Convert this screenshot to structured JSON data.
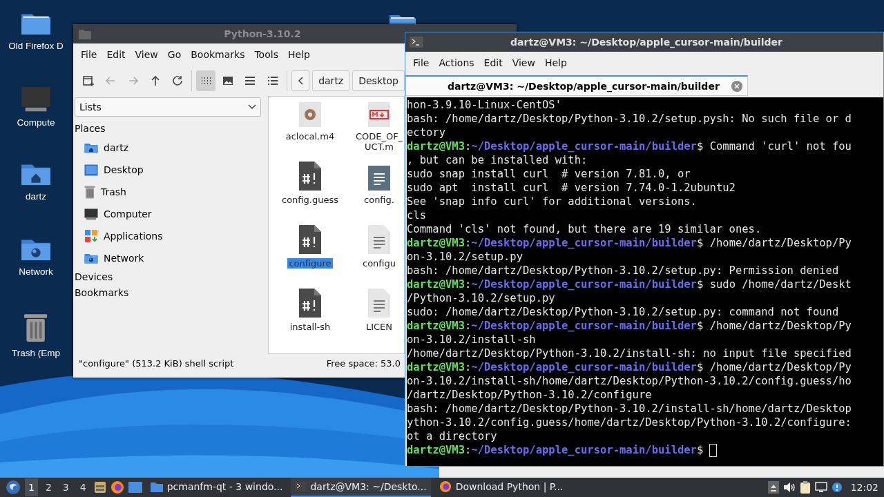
{
  "desktop_icons": [
    {
      "label": "Old Firefox D",
      "kind": "folder"
    },
    {
      "label": "Compute",
      "kind": "computer"
    },
    {
      "label": "dartz",
      "kind": "home"
    },
    {
      "label": "Network",
      "kind": "network"
    },
    {
      "label": "Trash (Emp",
      "kind": "trash"
    }
  ],
  "file_manager": {
    "title": "Python-3.10.2",
    "menu": [
      "File",
      "Edit",
      "View",
      "Go",
      "Bookmarks",
      "Tools",
      "Help"
    ],
    "toolbar": [
      {
        "kind": "new-window",
        "disabled": false,
        "selected": false
      },
      {
        "kind": "back",
        "disabled": true,
        "selected": false
      },
      {
        "kind": "forward",
        "disabled": true,
        "selected": false
      },
      {
        "kind": "up",
        "disabled": false,
        "selected": false
      },
      {
        "kind": "reload",
        "disabled": false,
        "selected": false
      },
      {
        "kind": "icon-view",
        "disabled": false,
        "selected": true
      },
      {
        "kind": "thumbnail-view",
        "disabled": false,
        "selected": false
      },
      {
        "kind": "compact-view",
        "disabled": false,
        "selected": false
      },
      {
        "kind": "detail-view",
        "disabled": false,
        "selected": false
      }
    ],
    "breadcrumbs": [
      "dartz",
      "Desktop"
    ],
    "sidebar": {
      "mode": "Lists",
      "sections": [
        {
          "title": "Places",
          "items": [
            {
              "label": "dartz",
              "kind": "home"
            },
            {
              "label": "Desktop",
              "kind": "desktop"
            },
            {
              "label": "Trash",
              "kind": "trash"
            },
            {
              "label": "Computer",
              "kind": "computer"
            },
            {
              "label": "Applications",
              "kind": "apps"
            },
            {
              "label": "Network",
              "kind": "network"
            }
          ]
        },
        {
          "title": "Devices"
        },
        {
          "title": "Bookmarks"
        }
      ]
    },
    "files": [
      {
        "lines": [
          "aclocal.m4"
        ],
        "kind": "config",
        "selected": false
      },
      {
        "lines": [
          "CODE_OF_",
          "UCT.m"
        ],
        "kind": "markdown",
        "selected": false
      },
      {
        "lines": [
          "config.guess"
        ],
        "kind": "script",
        "selected": false
      },
      {
        "lines": [
          "config."
        ],
        "kind": "document",
        "selected": false
      },
      {
        "lines": [
          "configure"
        ],
        "kind": "script",
        "selected": true
      },
      {
        "lines": [
          "configu"
        ],
        "kind": "text",
        "selected": false
      },
      {
        "lines": [
          "install-sh"
        ],
        "kind": "script",
        "selected": false
      },
      {
        "lines": [
          "LICEN"
        ],
        "kind": "text",
        "selected": false
      }
    ],
    "status": "\"configure\" (513.2 KiB) shell script",
    "free_space": "Free space: 53.0"
  },
  "terminal": {
    "title": "dartz@VM3: ~/Desktop/apple_cursor-main/builder",
    "menu": [
      "File",
      "Actions",
      "Edit",
      "View",
      "Help"
    ],
    "tab": {
      "label": "dartz@VM3: ~/Desktop/apple_cursor-main/builder",
      "selected": true
    },
    "lines": [
      {
        "kind": "output",
        "text": "hon-3.9.10-Linux-CentOS'"
      },
      {
        "kind": "output",
        "text": "bash: /home/dartz/Desktop/Python-3.10.2/setup.pysh: No such file or d"
      },
      {
        "kind": "output",
        "text": "ectory"
      },
      {
        "kind": "prompt",
        "user": "dartz@VM3",
        "sep": ":",
        "path": "~/Desktop/apple_cursor-main/builder",
        "command": "$ Command 'curl' not fou"
      },
      {
        "kind": "output",
        "text": ", but can be installed with:"
      },
      {
        "kind": "output",
        "text": "sudo snap install curl  # version 7.81.0, or"
      },
      {
        "kind": "output",
        "text": "sudo apt  install curl  # version 7.74.0-1.2ubuntu2"
      },
      {
        "kind": "output",
        "text": "See 'snap info curl' for additional versions."
      },
      {
        "kind": "output",
        "text": "cls"
      },
      {
        "kind": "output",
        "text": "Command 'cls' not found, but there are 19 similar ones."
      },
      {
        "kind": "prompt",
        "user": "dartz@VM3",
        "sep": ":",
        "path": "~/Desktop/apple_cursor-main/builder",
        "command": "$ /home/dartz/Desktop/Py"
      },
      {
        "kind": "output",
        "text": "on-3.10.2/setup.py"
      },
      {
        "kind": "output",
        "text": "bash: /home/dartz/Desktop/Python-3.10.2/setup.py: Permission denied"
      },
      {
        "kind": "prompt",
        "user": "dartz@VM3",
        "sep": ":",
        "path": "~/Desktop/apple_cursor-main/builder",
        "command": "$ sudo /home/dartz/Deskt"
      },
      {
        "kind": "output",
        "text": "/Python-3.10.2/setup.py"
      },
      {
        "kind": "output",
        "text": "sudo: /home/dartz/Desktop/Python-3.10.2/setup.py: command not found"
      },
      {
        "kind": "prompt",
        "user": "dartz@VM3",
        "sep": ":",
        "path": "~/Desktop/apple_cursor-main/builder",
        "command": "$ /home/dartz/Desktop/Py"
      },
      {
        "kind": "output",
        "text": "on-3.10.2/install-sh"
      },
      {
        "kind": "output",
        "text": "/home/dartz/Desktop/Python-3.10.2/install-sh: no input file specified"
      },
      {
        "kind": "prompt",
        "user": "dartz@VM3",
        "sep": ":",
        "path": "~/Desktop/apple_cursor-main/builder",
        "command": "$ /home/dartz/Desktop/Py"
      },
      {
        "kind": "output",
        "text": "on-3.10.2/install-sh/home/dartz/Desktop/Python-3.10.2/config.guess/ho"
      },
      {
        "kind": "output",
        "text": "/dartz/Desktop/Python-3.10.2/configure"
      },
      {
        "kind": "output",
        "text": "bash: /home/dartz/Desktop/Python-3.10.2/install-sh/home/dartz/Desktop"
      },
      {
        "kind": "output",
        "text": "ython-3.10.2/config.guess/home/dartz/Desktop/Python-3.10.2/configure:"
      },
      {
        "kind": "output",
        "text": "ot a directory"
      },
      {
        "kind": "prompt",
        "user": "dartz@VM3",
        "sep": ":",
        "path": "~/Desktop/apple_cursor-main/builder",
        "command": "$",
        "cursor": true
      }
    ]
  },
  "taskbar": {
    "workspaces": [
      {
        "label": "1",
        "selected": true
      },
      {
        "label": "2",
        "selected": false
      },
      {
        "label": "3",
        "selected": false
      },
      {
        "label": "4",
        "selected": false
      }
    ],
    "launchers": [
      {
        "kind": "files"
      },
      {
        "kind": "browser"
      },
      {
        "kind": "desktop"
      }
    ],
    "tasks": [
      {
        "label": "pcmanfm-qt - 3 windo...",
        "kind": "folder",
        "selected": false
      },
      {
        "label": "dartz@VM3: ~/Deskto...",
        "kind": "terminal",
        "selected": true
      },
      {
        "label": "Download Python | P...",
        "kind": "browser",
        "selected": false
      }
    ],
    "tray": [
      {
        "kind": "updates"
      },
      {
        "kind": "volume"
      },
      {
        "kind": "clipboard"
      },
      {
        "kind": "display"
      },
      {
        "kind": "notification"
      }
    ],
    "clock": "12:02"
  }
}
